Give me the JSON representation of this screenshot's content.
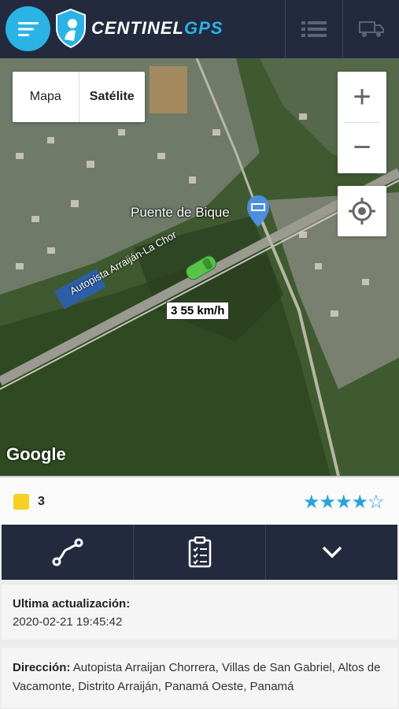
{
  "header": {
    "logo_text_main": "CENTINEL",
    "logo_text_accent": "GPS",
    "menu_icon": "hamburger-icon",
    "list_icon": "list-icon",
    "truck_icon": "truck-icon"
  },
  "map": {
    "type_map_label": "Mapa",
    "type_satellite_label": "Satélite",
    "zoom_in": "+",
    "zoom_out": "−",
    "place_label": "Puente de Bique",
    "road_label": "Autopista Arraiján-La Chor",
    "speed_label": "3 55 km/h",
    "attribution": "Google"
  },
  "info": {
    "key_count": "3",
    "rating": 4,
    "rating_max": 5
  },
  "tabs": [
    {
      "icon": "route-icon"
    },
    {
      "icon": "clipboard-icon"
    },
    {
      "icon": "chevron-down-icon"
    }
  ],
  "details": {
    "updated_label": "Ultima actualización:",
    "updated_value": "2020-02-21 19:45:42",
    "address_label": "Dirección:",
    "address_value": "Autopista Arraijan Chorrera, Villas de San Gabriel, Altos de Vacamonte, Distrito Arraiján, Panamá Oeste, Panamá"
  },
  "colors": {
    "header_bg": "#232a3e",
    "accent": "#2bb3e6",
    "star": "#29a3d8",
    "key": "#f4d21f"
  }
}
